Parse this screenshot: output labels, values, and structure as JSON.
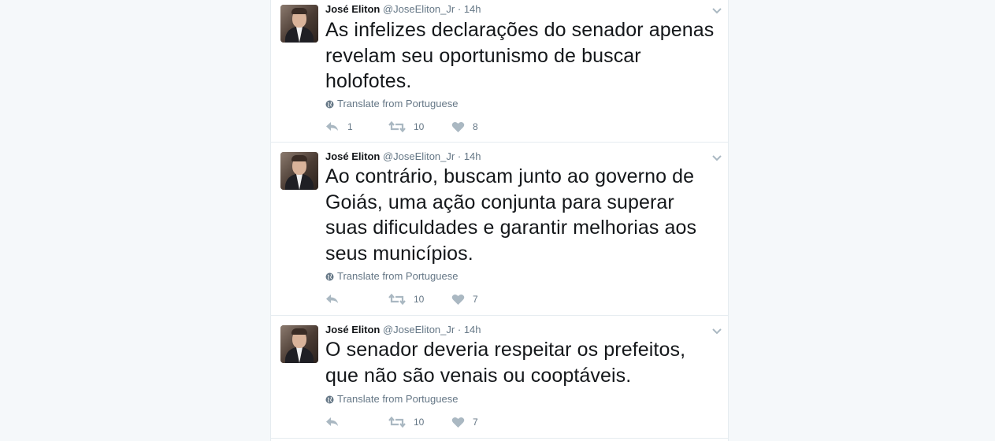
{
  "tweets": [
    {
      "name": "José Eliton",
      "handle": "@JoseEliton_Jr",
      "separator": "·",
      "time": "14h",
      "text": "As infelizes declarações do senador apenas revelam seu oportunismo de buscar holofotes.",
      "translate_label": "Translate from Portuguese",
      "reply_count": "1",
      "retweet_count": "10",
      "like_count": "8"
    },
    {
      "name": "José Eliton",
      "handle": "@JoseEliton_Jr",
      "separator": "·",
      "time": "14h",
      "text": "Ao contrário, buscam junto ao governo de Goiás, uma ação conjunta para superar suas dificuldades e garantir melhorias aos seus municípios.",
      "translate_label": "Translate from Portuguese",
      "reply_count": "",
      "retweet_count": "10",
      "like_count": "7"
    },
    {
      "name": "José Eliton",
      "handle": "@JoseEliton_Jr",
      "separator": "·",
      "time": "14h",
      "text": "O senador deveria respeitar os prefeitos, que não são venais ou cooptáveis.",
      "translate_label": "Translate from Portuguese",
      "reply_count": "",
      "retweet_count": "10",
      "like_count": "7"
    }
  ],
  "icons": {
    "reply": "reply-icon",
    "retweet": "retweet-icon",
    "like": "heart-icon",
    "translate": "globe-icon",
    "menu": "chevron-down-icon"
  },
  "colors": {
    "icon_gray": "#aab8c2",
    "text": "#14171a",
    "meta": "#657786"
  }
}
